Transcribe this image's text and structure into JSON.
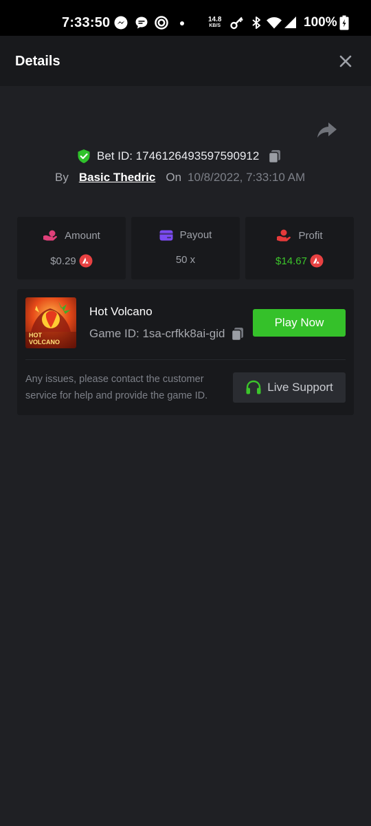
{
  "status_bar": {
    "time": "7:33:50",
    "net_speed_value": "14.8",
    "net_speed_unit": "KB/S",
    "battery": "100%",
    "icons": [
      "messenger-icon",
      "chat-icon",
      "ring-icon",
      "dot-icon",
      "key-icon",
      "bluetooth-icon",
      "wifi-icon",
      "signal-icon",
      "battery-charging-icon"
    ]
  },
  "header": {
    "title": "Details",
    "close_icon": "close-icon"
  },
  "bet": {
    "id_label": "Bet ID: 1746126493597590912",
    "by_label": "By",
    "user": "Basic Thedric",
    "on_label": "On",
    "date": "10/8/2022, 7:33:10 AM"
  },
  "stats": {
    "amount": {
      "label": "Amount",
      "value": "$0.29",
      "icon": "money-bag-icon",
      "color": "#e0407a"
    },
    "payout": {
      "label": "Payout",
      "value": "50 x",
      "icon": "card-icon",
      "color": "#7b4bf2"
    },
    "profit": {
      "label": "Profit",
      "value": "$14.67",
      "icon": "hand-coin-icon",
      "color": "#e53a3a"
    }
  },
  "game": {
    "name": "Hot Volcano",
    "id_text": "Game ID: 1sa-crfkk8ai-gid",
    "thumb_title_line1": "HOT",
    "thumb_title_line2": "VOLCANO",
    "play_label": "Play Now",
    "issue_text": "Any issues, please contact the customer service for help and provide the game ID.",
    "support_label": "Live Support"
  },
  "colors": {
    "accent_green": "#35c12a",
    "profit_green": "#3cc52b",
    "coin_red": "#e84142",
    "background": "#1f2024",
    "card": "#18191c"
  }
}
